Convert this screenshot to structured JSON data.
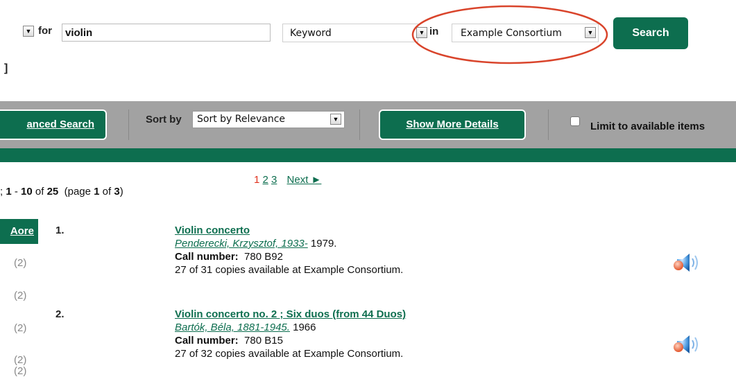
{
  "search": {
    "for_label": "for",
    "query": "violin",
    "search_type": "Keyword",
    "in_label": "in",
    "scope": "Example Consortium",
    "search_button": "Search",
    "bracket": "]"
  },
  "toolbar": {
    "advanced_search": "anced Search",
    "sort_label": "Sort by",
    "sort_value": "Sort by Relevance",
    "show_more_details": "Show More Details",
    "limit_label": "Limit to available items"
  },
  "results": {
    "range_prefix": "; ",
    "range_start": "1",
    "range_mid": " - ",
    "range_end": "10",
    "of_label": " of ",
    "total": "25",
    "page_open": "(page ",
    "page_current": "1",
    "page_of": " of ",
    "page_total": "3",
    "page_close": ")",
    "pages": [
      "1",
      "2",
      "3"
    ],
    "next_label": "Next ►"
  },
  "sidebar": {
    "more_button": "Aore",
    "facet_counts": [
      "(2)",
      "(2)",
      "(2)",
      "(2)",
      "(2)"
    ]
  },
  "records": [
    {
      "number": "1.",
      "title": "Violin concerto",
      "author": "Penderecki, Krzysztof, 1933-",
      "year": " 1979.",
      "call_label": "Call number:",
      "call_number": "780 B92",
      "availability": "27 of 31 copies available at Example Consortium."
    },
    {
      "number": "2.",
      "title": "Violin concerto no. 2 ; Six duos (from 44 Duos)",
      "author": "Bartók, Béla, 1881-1945.",
      "year": " 1966",
      "call_label": "Call number:",
      "call_number": "780 B15",
      "availability": "27 of 32 copies available at Example Consortium."
    }
  ],
  "colors": {
    "brand_green": "#0d6e4f",
    "gray_bar": "#a2a2a2",
    "annotation_red": "#d9442b",
    "current_page_red": "#e0321e"
  },
  "icons": {
    "audio": "speaker-sound-icon",
    "dropdown": "chevron-down-icon"
  }
}
